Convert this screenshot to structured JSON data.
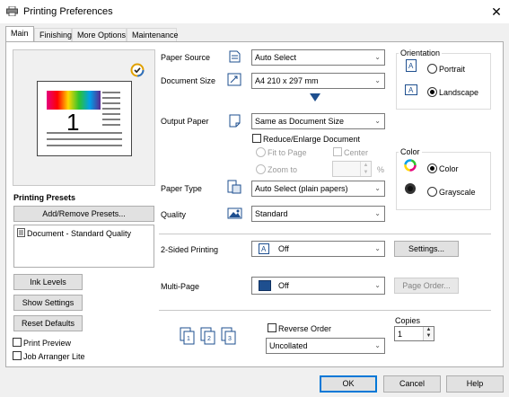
{
  "window": {
    "title": "Printing Preferences",
    "close_glyph": "✕"
  },
  "tabs": [
    {
      "label": "Main"
    },
    {
      "label": "Finishing"
    },
    {
      "label": "More Options"
    },
    {
      "label": "Maintenance"
    }
  ],
  "preview": {
    "page_number": "1"
  },
  "presets": {
    "heading": "Printing Presets",
    "add_remove_button": "Add/Remove Presets...",
    "items": [
      "Document - Standard Quality"
    ]
  },
  "left_buttons": {
    "ink_levels": "Ink Levels",
    "show_settings": "Show Settings",
    "reset_defaults": "Reset Defaults"
  },
  "left_checks": {
    "print_preview": "Print Preview",
    "job_arranger": "Job Arranger Lite"
  },
  "settings": {
    "paper_source": {
      "label": "Paper Source",
      "value": "Auto Select"
    },
    "document_size": {
      "label": "Document Size",
      "value": "A4 210 x 297 mm"
    },
    "output_paper": {
      "label": "Output Paper",
      "value": "Same as Document Size"
    },
    "reduce_enlarge": "Reduce/Enlarge Document",
    "fit_to_page": "Fit to Page",
    "center": "Center",
    "zoom_to": "Zoom to",
    "zoom_unit": "%",
    "paper_type": {
      "label": "Paper Type",
      "value": "Auto Select (plain papers)"
    },
    "quality": {
      "label": "Quality",
      "value": "Standard"
    },
    "two_sided": {
      "label": "2-Sided Printing",
      "value": "Off",
      "settings_button": "Settings..."
    },
    "multi_page": {
      "label": "Multi-Page",
      "value": "Off",
      "page_order_button": "Page Order..."
    },
    "reverse_order": "Reverse Order",
    "collate": {
      "value": "Uncollated"
    },
    "copies": {
      "label": "Copies",
      "value": "1"
    }
  },
  "orientation": {
    "title": "Orientation",
    "portrait": "Portrait",
    "landscape": "Landscape",
    "selected": "landscape"
  },
  "color": {
    "title": "Color",
    "color": "Color",
    "grayscale": "Grayscale",
    "selected": "color"
  },
  "footer": {
    "ok": "OK",
    "cancel": "Cancel",
    "help": "Help"
  },
  "colors": {
    "accent": "#0078d7",
    "multipage_icon": "#1e4f8f",
    "dropdown_arrow": "#1e4f8f"
  }
}
